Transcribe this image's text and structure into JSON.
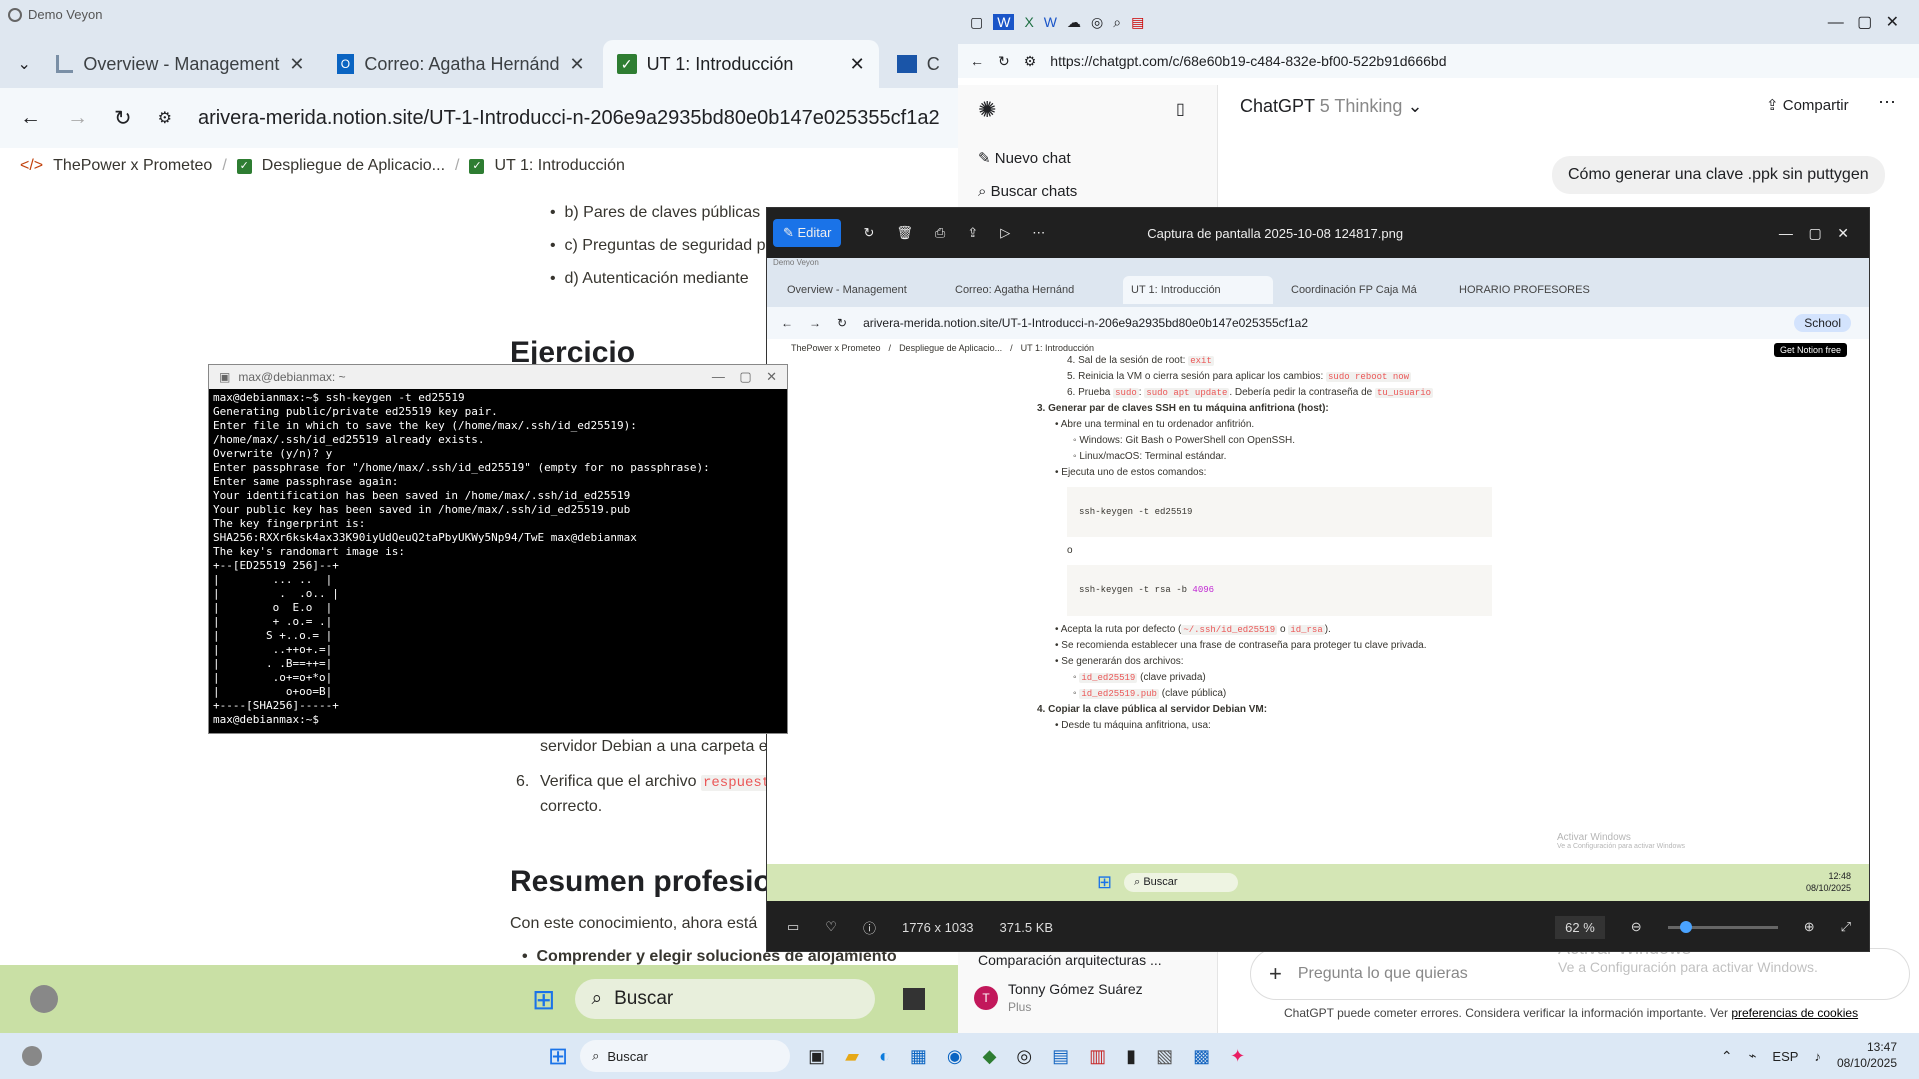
{
  "left_browser": {
    "window_title": "Demo Veyon",
    "tabs": [
      {
        "label": "Overview - Management"
      },
      {
        "label": "Correo: Agatha Hernánd"
      },
      {
        "label": "UT 1: Introducción"
      },
      {
        "label": "C"
      }
    ],
    "url": "arivera-merida.notion.site/UT-1-Introducci-n-206e9a2935bd80e0b147e025355cf1a2",
    "breadcrumb": [
      "ThePower x Prometeo",
      "Despliegue de Aplicacio...",
      "UT 1: Introducción"
    ],
    "content": {
      "list_b": "b) Pares de claves públicas",
      "list_c": "c) Preguntas de seguridad p",
      "list_d": "d) Autenticación mediante",
      "heading_ejercicio": "Ejercicio",
      "step5_tail": "servidor Debian a una carpeta e",
      "step6_number": "6.",
      "step6_text": "Verifica que el archivo",
      "step6_code": "respuest",
      "step6_tail": "correcto.",
      "heading_resumen": "Resumen profesio",
      "resumen_text": "Con este conocimiento, ahora está",
      "bullet_comprender": "Comprender y elegir soluciones de alojamiento flexibles"
    }
  },
  "right_browser": {
    "tabs_count_visible": "many",
    "url": "https://chatgpt.com/c/68e60b19-c484-832e-bf00-522b91d666bd",
    "sidebar": {
      "new_chat": "Nuevo chat",
      "search_chats": "Buscar chats",
      "recent": "Comparación arquitecturas ...",
      "user_name": "Tonny Gómez Suárez",
      "user_plan": "Plus",
      "user_initial": "T"
    },
    "header": {
      "model": "ChatGPT",
      "model_variant": "5 Thinking",
      "share": "Compartir"
    },
    "user_message": "Cómo generar una clave .ppk sin puttygen",
    "input_placeholder": "Pregunta lo que quieras",
    "disclaimer": "ChatGPT puede cometer errores. Considera verificar la información importante. Ver",
    "disclaimer_link": "preferencias de cookies",
    "activate_windows": "Activar Windows",
    "activate_windows_sub": "Ve a Configuración para activar Windows."
  },
  "photo_viewer": {
    "edit_label": "Editar",
    "title": "Captura de pantalla 2025-10-08 124817.png",
    "dimensions": "1776 x 1033",
    "filesize": "371.5 KB",
    "zoom": "62 %",
    "inner": {
      "window_title": "Demo Veyon",
      "tabs": [
        "Overview - Management",
        "Correo: Agatha Hernánd",
        "UT 1: Introducción",
        "Coordinación FP Caja Má",
        "HORARIO PROFESORES"
      ],
      "url": "arivera-merida.notion.site/UT-1-Introducci-n-206e9a2935bd80e0b147e025355cf1a2",
      "school_badge": "School",
      "breadcrumb": [
        "ThePower x Prometeo",
        "Despliegue de Aplicacio...",
        "UT 1: Introducción"
      ],
      "get_notion": "Get Notion free",
      "doc": {
        "item4": "Sal de la sesión de root:",
        "item4_code": "exit",
        "item5": "Reinicia la VM o cierra sesión para aplicar los cambios:",
        "item5_code": "sudo reboot now",
        "item6_a": "Prueba",
        "item6_code1": "sudo",
        "item6_code2": "sudo apt update",
        "item6_b": ". Debería pedir la contraseña de",
        "item6_code3": "tu_usuario",
        "step3": "Generar par de claves SSH en tu máquina anfitriona (host):",
        "b1": "Abre una terminal en tu ordenador anfitrión.",
        "b1a": "Windows: Git Bash o PowerShell con OpenSSH.",
        "b1b": "Linux/macOS: Terminal estándar.",
        "b2": "Ejecuta uno de estos comandos:",
        "cmd1": "ssh-keygen -t ed25519",
        "or": "o",
        "cmd2_prefix": "ssh-keygen -t rsa -b ",
        "cmd2_num": "4096",
        "b3_a": "Acepta la ruta por defecto (",
        "b3_code1": "~/.ssh/id_ed25519",
        "b3_mid": "o",
        "b3_code2": "id_rsa",
        "b3_b": ").",
        "b4": "Se recomienda establecer una frase de contraseña para proteger tu clave privada.",
        "b5": "Se generarán dos archivos:",
        "f1_code": "id_ed25519",
        "f1": "(clave privada)",
        "f2_code": "id_ed25519.pub",
        "f2": "(clave pública)",
        "step4": "Copiar la clave pública al servidor Debian VM:",
        "b6": "Desde tu máquina anfitriona, usa:"
      },
      "taskbar_search": "Buscar",
      "time": "12:48",
      "date": "08/10/2025",
      "activate": "Activar Windows",
      "activate_sub": "Ve a Configuración para activar Windows"
    }
  },
  "terminal": {
    "title": "max@debianmax: ~",
    "lines": "max@debianmax:~$ ssh-keygen -t ed25519\nGenerating public/private ed25519 key pair.\nEnter file in which to save the key (/home/max/.ssh/id_ed25519):\n/home/max/.ssh/id_ed25519 already exists.\nOverwrite (y/n)? y\nEnter passphrase for \"/home/max/.ssh/id_ed25519\" (empty for no passphrase):\nEnter same passphrase again:\nYour identification has been saved in /home/max/.ssh/id_ed25519\nYour public key has been saved in /home/max/.ssh/id_ed25519.pub\nThe key fingerprint is:\nSHA256:RXXr6ksk4ax33K90iyUdQeuQ2taPbyUKWy5Np94/TwE max@debianmax\nThe key's randomart image is:\n+--[ED25519 256]--+\n|        ... ..  |\n|         .  .o.. |\n|        o  E.o  |\n|        + .o.= .|\n|       S +..o.= |\n|        ..++o+.=|\n|       . .B==++=|\n|        .o+=o+*o|\n|          o+oo=B|\n+----[SHA256]-----+\nmax@debianmax:~$ "
  },
  "inner_taskbar": {
    "search": "Buscar"
  },
  "main_taskbar": {
    "search": "Buscar",
    "lang": "ESP",
    "time": "13:47",
    "date": "08/10/2025"
  }
}
